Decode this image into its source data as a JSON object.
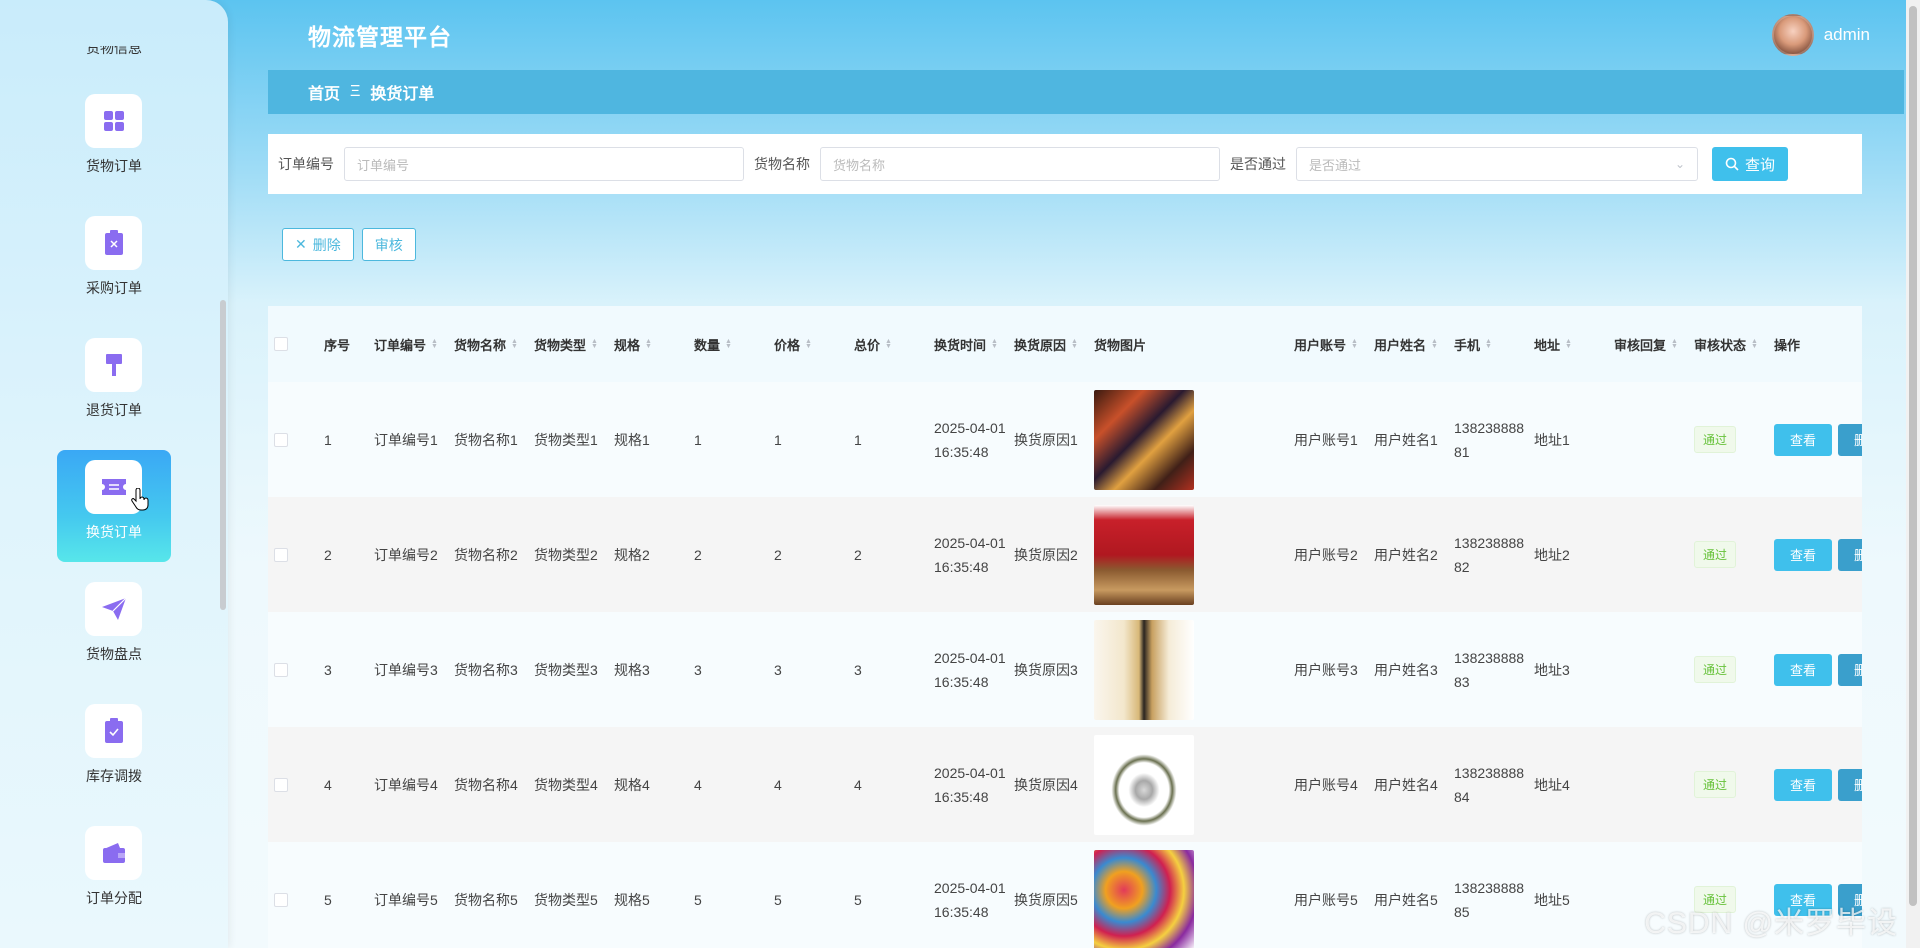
{
  "header": {
    "title": "物流管理平台",
    "username": "admin"
  },
  "breadcrumb": {
    "home": "首页",
    "separator": "Ξ",
    "current": "换货订单"
  },
  "sidebar": {
    "partial_label": "货物信息",
    "items": [
      {
        "label": "货物订单",
        "icon": "grid-icon"
      },
      {
        "label": "采购订单",
        "icon": "clipboard-x-icon"
      },
      {
        "label": "退货订单",
        "icon": "brush-icon"
      },
      {
        "label": "换货订单",
        "icon": "ticket-icon",
        "active": true
      },
      {
        "label": "货物盘点",
        "icon": "paper-plane-icon"
      },
      {
        "label": "库存调拨",
        "icon": "clipboard-check-icon"
      },
      {
        "label": "订单分配",
        "icon": "wallet-icon"
      }
    ]
  },
  "search": {
    "order_no_label": "订单编号",
    "order_no_placeholder": "订单编号",
    "goods_name_label": "货物名称",
    "goods_name_placeholder": "货物名称",
    "passed_label": "是否通过",
    "passed_placeholder": "是否通过",
    "query_label": "查询"
  },
  "actions": {
    "delete_label": "删除",
    "review_label": "审核"
  },
  "table": {
    "headers": {
      "index": "序号",
      "order_no": "订单编号",
      "goods_name": "货物名称",
      "goods_type": "货物类型",
      "spec": "规格",
      "qty": "数量",
      "price": "价格",
      "total": "总价",
      "time": "换货时间",
      "reason": "换货原因",
      "image": "货物图片",
      "account": "用户账号",
      "user_name": "用户姓名",
      "phone": "手机",
      "address": "地址",
      "reply": "审核回复",
      "status": "审核状态",
      "ops": "操作"
    },
    "view_label": "查看",
    "delete_label": "删",
    "rows": [
      {
        "index": "1",
        "order_no": "订单编号1",
        "goods_name": "货物名称1",
        "goods_type": "货物类型1",
        "spec": "规格1",
        "qty": "1",
        "price": "1",
        "total": "1",
        "time": "2025-04-01 16:35:48",
        "reason": "换货原因1",
        "account": "用户账号1",
        "user_name": "用户姓名1",
        "phone": "13823888881",
        "address": "地址1",
        "status": "通过"
      },
      {
        "index": "2",
        "order_no": "订单编号2",
        "goods_name": "货物名称2",
        "goods_type": "货物类型2",
        "spec": "规格2",
        "qty": "2",
        "price": "2",
        "total": "2",
        "time": "2025-04-01 16:35:48",
        "reason": "换货原因2",
        "account": "用户账号2",
        "user_name": "用户姓名2",
        "phone": "13823888882",
        "address": "地址2",
        "status": "通过"
      },
      {
        "index": "3",
        "order_no": "订单编号3",
        "goods_name": "货物名称3",
        "goods_type": "货物类型3",
        "spec": "规格3",
        "qty": "3",
        "price": "3",
        "total": "3",
        "time": "2025-04-01 16:35:48",
        "reason": "换货原因3",
        "account": "用户账号3",
        "user_name": "用户姓名3",
        "phone": "13823888883",
        "address": "地址3",
        "status": "通过"
      },
      {
        "index": "4",
        "order_no": "订单编号4",
        "goods_name": "货物名称4",
        "goods_type": "货物类型4",
        "spec": "规格4",
        "qty": "4",
        "price": "4",
        "total": "4",
        "time": "2025-04-01 16:35:48",
        "reason": "换货原因4",
        "account": "用户账号4",
        "user_name": "用户姓名4",
        "phone": "13823888884",
        "address": "地址4",
        "status": "通过"
      },
      {
        "index": "5",
        "order_no": "订单编号5",
        "goods_name": "货物名称5",
        "goods_type": "货物类型5",
        "spec": "规格5",
        "qty": "5",
        "price": "5",
        "total": "5",
        "time": "2025-04-01 16:35:48",
        "reason": "换货原因5",
        "account": "用户账号5",
        "user_name": "用户姓名5",
        "phone": "13823888885",
        "address": "地址5",
        "status": "通过"
      }
    ]
  },
  "watermark": "CSDN @米罗毕设"
}
